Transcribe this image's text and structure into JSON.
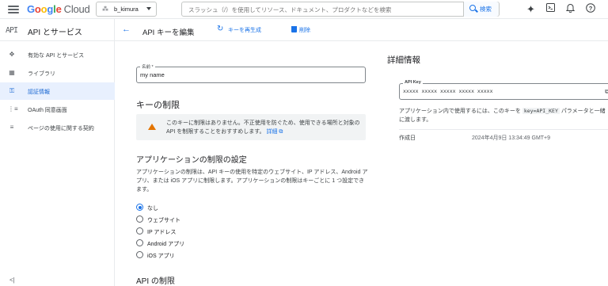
{
  "topbar": {
    "logo": {
      "part1": "G",
      "part2": "o",
      "part3": "o",
      "part4": "g",
      "part5": "l",
      "part6": "e",
      "cloud": "Cloud"
    },
    "project": "b_kimura",
    "search_placeholder": "スラッシュ（/）を使用してリソース、ドキュメント、プロダクトなどを検索",
    "search_button": "検索",
    "icons": [
      "gemini-icon",
      "terminal-icon",
      "bell-icon",
      "help-icon"
    ]
  },
  "sidebar": {
    "api_label": "API",
    "title": "API とサービス",
    "items": [
      {
        "label": "有効な API とサービス",
        "icon": "diamond-icon"
      },
      {
        "label": "ライブラリ",
        "icon": "library-icon"
      },
      {
        "label": "認証情報",
        "icon": "key-icon",
        "active": true
      },
      {
        "label": "OAuth 同意画面",
        "icon": "consent-icon"
      },
      {
        "label": "ページの使用に関する契約",
        "icon": "settings-list-icon"
      }
    ],
    "collapse": "<|"
  },
  "pagebar": {
    "title": "API キーを編集",
    "regenerate": "キーを再生成",
    "delete": "削除"
  },
  "form": {
    "name_label": "名前 *",
    "name_value": "my name",
    "key_restrictions_heading": "キーの制限",
    "warning_text": "このキーに制限はありません。不正使用を防ぐため、使用できる場所と対象の API を制限することをおすすめします。",
    "warning_link": "詳細",
    "app_restrictions_heading": "アプリケーションの制限の設定",
    "app_restrictions_desc": "アプリケーションの制限は、API キーの使用を特定のウェブサイト、IP アドレス、Android アプリ、または iOS アプリに制限します。アプリケーションの制限はキーごとに 1 つ設定できます。",
    "options": [
      "なし",
      "ウェブサイト",
      "IP アドレス",
      "Android アプリ",
      "iOS アプリ"
    ],
    "selected_option": "なし",
    "api_restrictions_heading": "API の制限"
  },
  "details": {
    "heading": "詳細情報",
    "key_label": "API Key",
    "key_value": "xxxxx xxxxx xxxxx xxxxx xxxxx",
    "usage_pre": "アプリケーション内で使用するには、このキーを",
    "usage_code": "key=API_KEY",
    "usage_post": "パラメータと一緒に渡します。",
    "created_label": "作成日",
    "created_value": "2024年4月9日 13:34:49 GMT+9"
  }
}
